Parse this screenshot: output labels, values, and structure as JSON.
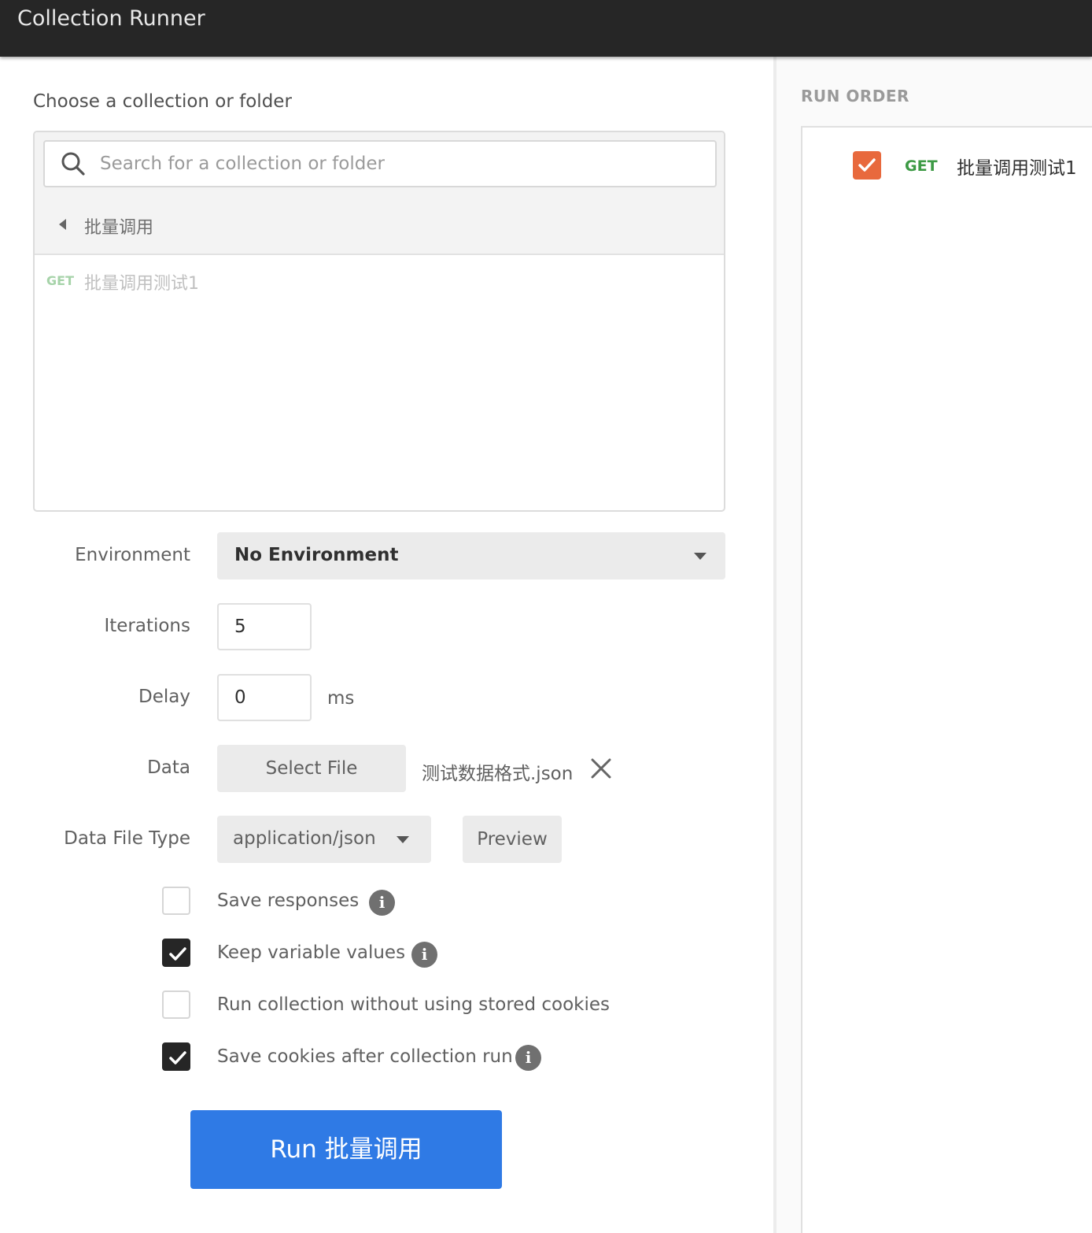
{
  "window": {
    "title": "Collection Runner"
  },
  "collections": {
    "label": "Choose a collection or folder",
    "search_placeholder": "Search for a collection or folder",
    "folder": "批量调用",
    "requests": [
      {
        "method": "GET",
        "name": "批量调用测试1"
      }
    ]
  },
  "form": {
    "environment": {
      "label": "Environment",
      "value": "No Environment"
    },
    "iterations": {
      "label": "Iterations",
      "value": "5"
    },
    "delay": {
      "label": "Delay",
      "value": "0",
      "unit": "ms"
    },
    "data": {
      "label": "Data",
      "select_label": "Select File",
      "file_name": "测试数据格式.json"
    },
    "data_file_type": {
      "label": "Data File Type",
      "value": "application/json",
      "preview_label": "Preview"
    }
  },
  "options": [
    {
      "label": "Save responses",
      "checked": false,
      "info": true
    },
    {
      "label": "Keep variable values",
      "checked": true,
      "info": true
    },
    {
      "label": "Run collection without using stored cookies",
      "checked": false,
      "info": false
    },
    {
      "label": "Save cookies after collection run",
      "checked": true,
      "info": true
    }
  ],
  "run_button": "Run 批量调用",
  "run_order": {
    "label": "RUN ORDER",
    "items": [
      {
        "checked": true,
        "method": "GET",
        "name": "批量调用测试1"
      }
    ]
  },
  "colors": {
    "primary": "#2f7ae5",
    "accent": "#e8693d",
    "get_method": "#3d9a45",
    "titlebar": "#262626"
  },
  "icons": {
    "search": "search-icon",
    "caret": "caret-left-icon",
    "dropdown": "chevron-down-icon",
    "remove": "close-icon",
    "info": "info-icon",
    "check": "check-icon"
  }
}
